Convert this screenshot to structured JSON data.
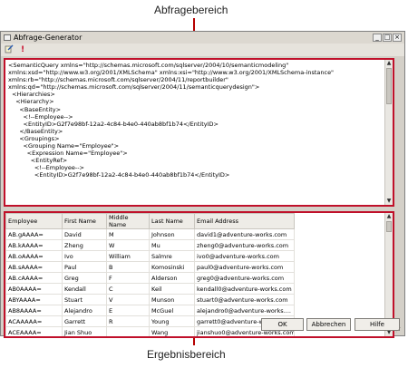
{
  "callouts": {
    "query_area": "Abfragebereich",
    "results_area": "Ergebnisbereich"
  },
  "window": {
    "title": "Abfrage-Generator",
    "controls": {
      "minimize": "_",
      "maximize": "□",
      "close": "×"
    }
  },
  "toolbar": {
    "items": [
      {
        "icon": "edit-query-icon"
      },
      {
        "icon": "run-query-icon",
        "glyph": "!"
      }
    ]
  },
  "query_text": "<SemanticQuery xmlns=\"http://schemas.microsoft.com/sqlserver/2004/10/semanticmodeling\"\nxmlns:xsd=\"http://www.w3.org/2001/XMLSchema\" xmlns:xsi=\"http://www.w3.org/2001/XMLSchema-instance\"\nxmlns:rb=\"http://schemas.microsoft.com/sqlserver/2004/11/reportbuilder\"\nxmlns:qd=\"http://schemas.microsoft.com/sqlserver/2004/11/semanticquerydesign\">\n  <Hierarchies>\n    <Hierarchy>\n      <BaseEntity>\n        <!--Employee-->\n        <EntityID>G2f7e98bf-12a2-4c84-b4e0-440ab8bf1b74</EntityID>\n      </BaseEntity>\n      <Groupings>\n        <Grouping Name=\"Employee\">\n          <Expression Name=\"Employee\">\n            <EntityRef>\n              <!--Employee-->\n              <EntityID>G2f7e98bf-12a2-4c84-b4e0-440ab8bf1b74</EntityID>",
  "results": {
    "columns": [
      "Employee",
      "First Name",
      "Middle Name",
      "Last Name",
      "Email Address"
    ],
    "rows": [
      [
        "AB.gAAAA=",
        "David",
        "M",
        "Johnson",
        "david1@adventure-works.com"
      ],
      [
        "AB.kAAAA=",
        "Zheng",
        "W",
        "Mu",
        "zheng0@adventure-works.com"
      ],
      [
        "AB.oAAAA=",
        "Ivo",
        "William",
        "Salmre",
        "ivo0@adventure-works.com"
      ],
      [
        "AB.sAAAA=",
        "Paul",
        "B",
        "Komosinski",
        "paul0@adventure-works.com"
      ],
      [
        "AB.cAAAA=",
        "Greg",
        "F",
        "Alderson",
        "greg0@adventure-works.com"
      ],
      [
        "AB0AAAA=",
        "Kendall",
        "C",
        "Keil",
        "kendall0@adventure-works.com"
      ],
      [
        "ABYAAAA=",
        "Stuart",
        "V",
        "Munson",
        "stuart0@adventure-works.com"
      ],
      [
        "AB8AAAA=",
        "Alejandro",
        "E",
        "McGuel",
        "alejandro0@adventure-works...."
      ],
      [
        "ACAAAAA=",
        "Garrett",
        "R",
        "Young",
        "garrett0@adventure-works.com"
      ],
      [
        "ACEAAAA=",
        "Jian Shuo",
        "",
        "Wang",
        "jianshuo0@adventure-works.com"
      ]
    ]
  },
  "buttons": {
    "ok": "OK",
    "cancel": "Abbrechen",
    "help": "Hilfe"
  },
  "colors": {
    "callout_line": "#b50000",
    "pane_highlight": "#c0102a"
  }
}
